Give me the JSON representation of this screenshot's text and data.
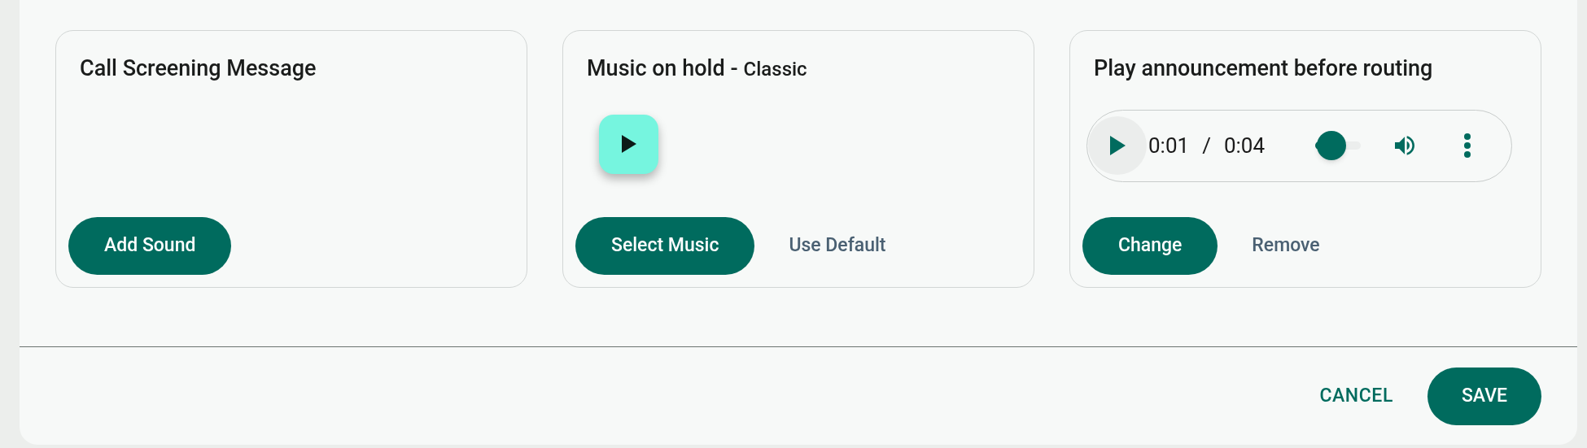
{
  "cards": [
    {
      "kind": "empty",
      "title": "Call Screening Message",
      "buttons": [
        {
          "label": "Add Sound",
          "kind": "primary"
        }
      ]
    },
    {
      "kind": "play_button",
      "title": "Music on hold -",
      "subtitle": "Classic",
      "buttons": [
        {
          "label": "Select Music",
          "kind": "primary"
        },
        {
          "label": "Use Default",
          "kind": "text"
        }
      ]
    },
    {
      "kind": "audio_player",
      "title": "Play announcement before routing",
      "player": {
        "current": "0:01",
        "separator": "/",
        "duration": "0:04"
      },
      "buttons": [
        {
          "label": "Change",
          "kind": "primary"
        },
        {
          "label": "Remove",
          "kind": "text"
        }
      ]
    }
  ],
  "footer": {
    "buttons": [
      {
        "label": "CANCEL",
        "kind": "text"
      },
      {
        "label": "SAVE",
        "kind": "primary"
      }
    ]
  }
}
